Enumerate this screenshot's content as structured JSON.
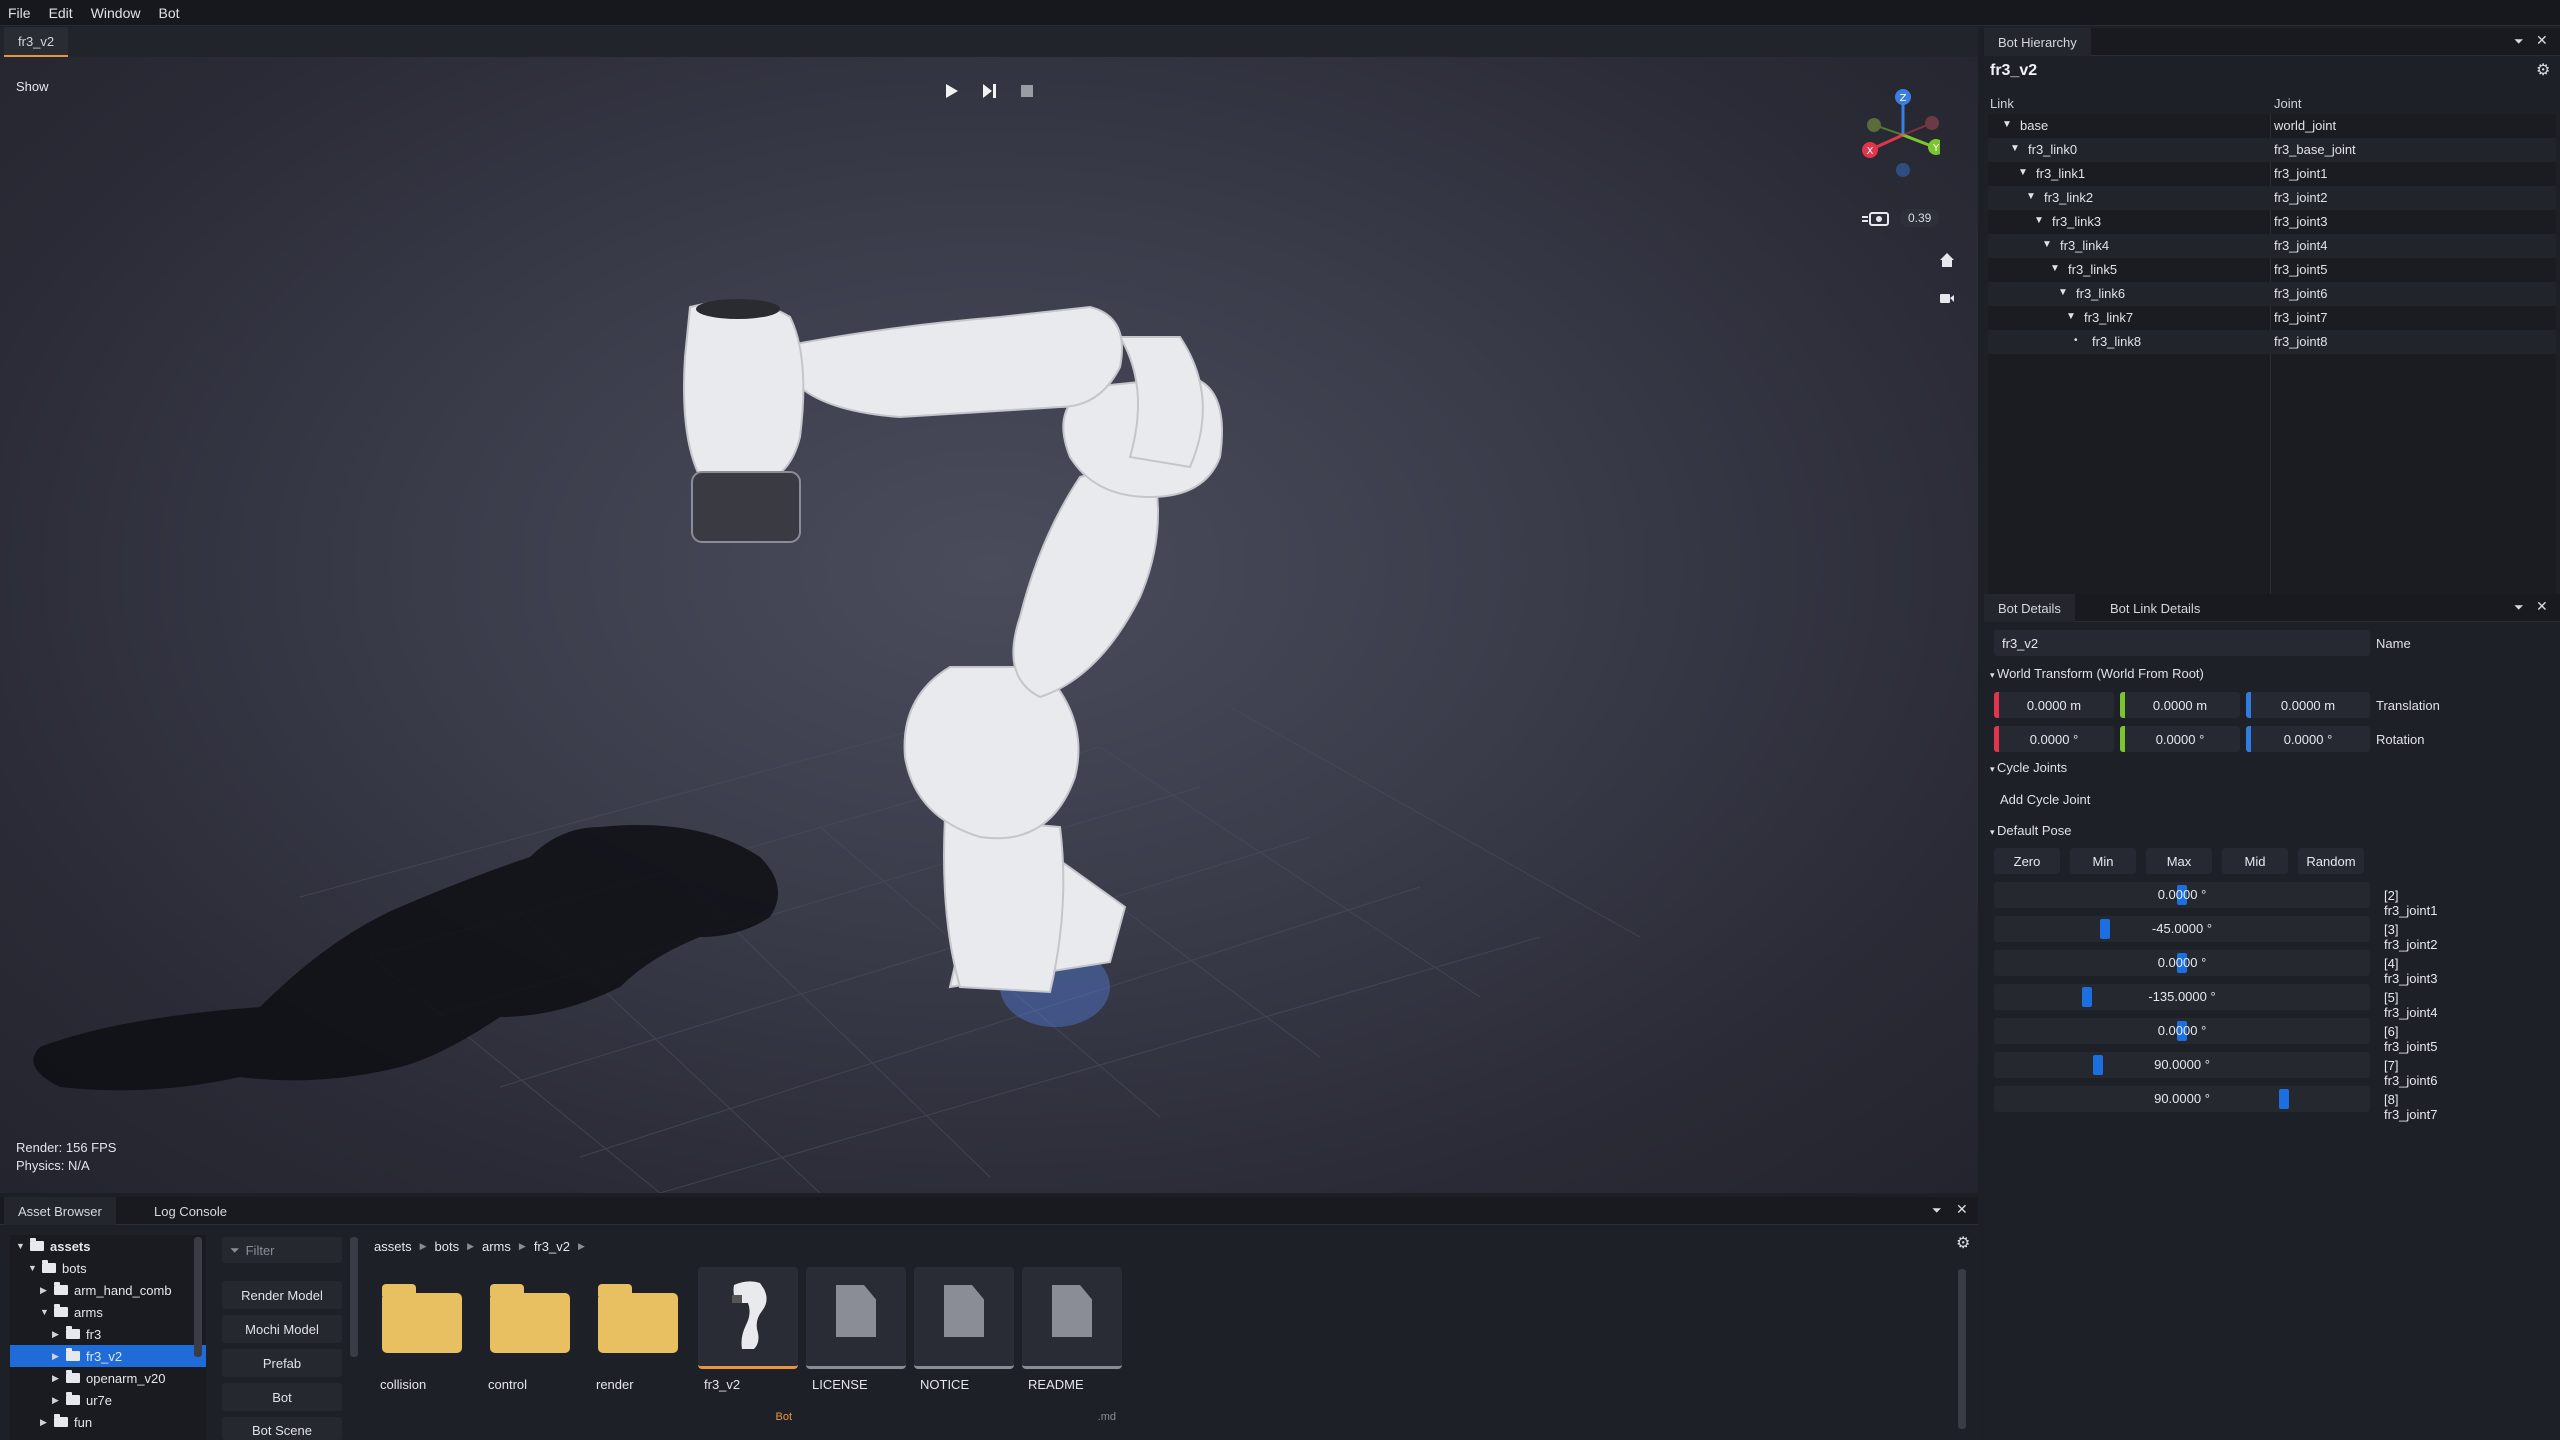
{
  "menu": [
    "File",
    "Edit",
    "Window",
    "Bot"
  ],
  "viewport": {
    "tab": "fr3_v2",
    "show_label": "Show",
    "camera_speed": "0.39",
    "stats": {
      "render": "Render:  156 FPS",
      "physics": "Physics: N/A"
    },
    "gizmo_axes": [
      "Z",
      "X",
      "Y"
    ]
  },
  "hierarchy": {
    "tab": "Bot Hierarchy",
    "title": "fr3_v2",
    "columns": [
      "Link",
      "Joint"
    ],
    "rows": [
      {
        "link": "base",
        "joint": "world_joint"
      },
      {
        "link": "fr3_link0",
        "joint": "fr3_base_joint"
      },
      {
        "link": "fr3_link1",
        "joint": "fr3_joint1"
      },
      {
        "link": "fr3_link2",
        "joint": "fr3_joint2"
      },
      {
        "link": "fr3_link3",
        "joint": "fr3_joint3"
      },
      {
        "link": "fr3_link4",
        "joint": "fr3_joint4"
      },
      {
        "link": "fr3_link5",
        "joint": "fr3_joint5"
      },
      {
        "link": "fr3_link6",
        "joint": "fr3_joint6"
      },
      {
        "link": "fr3_link7",
        "joint": "fr3_joint7"
      },
      {
        "link": "fr3_link8",
        "joint": "fr3_joint8"
      }
    ]
  },
  "details": {
    "tabs": [
      "Bot Details",
      "Bot Link Details"
    ],
    "name_value": "fr3_v2",
    "name_label": "Name",
    "world_transform_header": "World Transform (World From Root)",
    "translation": [
      "0.0000 m",
      "0.0000 m",
      "0.0000 m"
    ],
    "translation_label": "Translation",
    "rotation": [
      "0.0000 °",
      "0.0000 °",
      "0.0000 °"
    ],
    "rotation_label": "Rotation",
    "axis_colors": [
      "#e0364b",
      "#7bc62d",
      "#2f7de1"
    ],
    "cycle_joints_header": "Cycle Joints",
    "add_cycle_joint": "Add Cycle Joint",
    "default_pose_header": "Default Pose",
    "pose_buttons": [
      "Zero",
      "Min",
      "Max",
      "Mid",
      "Random"
    ],
    "joints": [
      {
        "value": "0.0000 °",
        "label": "[2] fr3_joint1",
        "fraction": 0.5
      },
      {
        "value": "-45.0000 °",
        "label": "[3] fr3_joint2",
        "fraction": 0.29
      },
      {
        "value": "0.0000 °",
        "label": "[4] fr3_joint3",
        "fraction": 0.5
      },
      {
        "value": "-135.0000 °",
        "label": "[5] fr3_joint4",
        "fraction": 0.24
      },
      {
        "value": "0.0000 °",
        "label": "[6] fr3_joint5",
        "fraction": 0.5
      },
      {
        "value": "90.0000 °",
        "label": "[7] fr3_joint6",
        "fraction": 0.27
      },
      {
        "value": "90.0000 °",
        "label": "[8] fr3_joint7",
        "fraction": 0.78
      }
    ]
  },
  "asset_browser": {
    "tabs": [
      "Asset Browser",
      "Log Console"
    ],
    "tree": [
      {
        "label": "assets",
        "depth": 0,
        "open": true,
        "bold": true
      },
      {
        "label": "bots",
        "depth": 1,
        "open": true
      },
      {
        "label": "arm_hand_comb",
        "depth": 2,
        "open": false
      },
      {
        "label": "arms",
        "depth": 2,
        "open": true
      },
      {
        "label": "fr3",
        "depth": 3,
        "open": false
      },
      {
        "label": "fr3_v2",
        "depth": 3,
        "open": false,
        "selected": true
      },
      {
        "label": "openarm_v20",
        "depth": 3,
        "open": false
      },
      {
        "label": "ur7e",
        "depth": 3,
        "open": false
      },
      {
        "label": "fun",
        "depth": 2,
        "open": false
      }
    ],
    "filter_placeholder": "Filter",
    "type_filters": [
      "Render Model",
      "Mochi Model",
      "Prefab",
      "Bot",
      "Bot Scene"
    ],
    "breadcrumb": [
      "assets",
      "bots",
      "arms",
      "fr3_v2"
    ],
    "items": [
      {
        "name": "collision",
        "kind": "folder",
        "tag": ""
      },
      {
        "name": "control",
        "kind": "folder",
        "tag": ""
      },
      {
        "name": "render",
        "kind": "folder",
        "tag": ""
      },
      {
        "name": "fr3_v2",
        "kind": "bot",
        "tag": "Bot"
      },
      {
        "name": "LICENSE",
        "kind": "file",
        "tag": ""
      },
      {
        "name": "NOTICE",
        "kind": "file",
        "tag": ""
      },
      {
        "name": "README",
        "kind": "file",
        "tag": ".md"
      }
    ]
  }
}
